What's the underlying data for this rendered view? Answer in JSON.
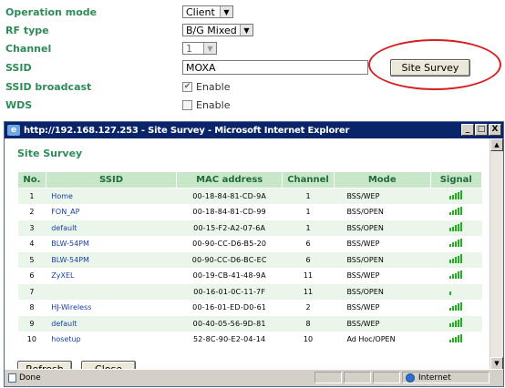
{
  "settings": {
    "operation_mode": {
      "label": "Operation mode",
      "value": "Client"
    },
    "rf_type": {
      "label": "RF type",
      "value": "B/G Mixed"
    },
    "channel": {
      "label": "Channel",
      "value": "1"
    },
    "ssid": {
      "label": "SSID",
      "value": "MOXA",
      "button": "Site Survey"
    },
    "ssid_broadcast": {
      "label": "SSID broadcast",
      "checkbox_label": "Enable",
      "checked": true
    },
    "wds": {
      "label": "WDS",
      "checkbox_label": "Enable",
      "checked": false
    },
    "highlight_color": "#d42020"
  },
  "window": {
    "title": "http://192.168.127.253 - Site Survey - Microsoft Internet Explorer",
    "controls": {
      "minimize": "_",
      "maximize": "□",
      "close": "X"
    }
  },
  "survey": {
    "title": "Site Survey",
    "columns": [
      "No.",
      "SSID",
      "MAC address",
      "Channel",
      "Mode",
      "Signal"
    ],
    "rows": [
      {
        "no": "1",
        "ssid": "Home",
        "mac": "00-18-84-81-CD-9A",
        "channel": "1",
        "mode": "BSS/WEP",
        "signal": 5
      },
      {
        "no": "2",
        "ssid": "FON_AP",
        "mac": "00-18-84-81-CD-99",
        "channel": "1",
        "mode": "BSS/OPEN",
        "signal": 5
      },
      {
        "no": "3",
        "ssid": "default",
        "mac": "00-15-F2-A2-07-6A",
        "channel": "1",
        "mode": "BSS/OPEN",
        "signal": 5
      },
      {
        "no": "4",
        "ssid": "BLW-54PM",
        "mac": "00-90-CC-D6-B5-20",
        "channel": "6",
        "mode": "BSS/WEP",
        "signal": 5
      },
      {
        "no": "5",
        "ssid": "BLW-54PM",
        "mac": "00-90-CC-D6-BC-EC",
        "channel": "6",
        "mode": "BSS/OPEN",
        "signal": 5
      },
      {
        "no": "6",
        "ssid": "ZyXEL",
        "mac": "00-19-CB-41-48-9A",
        "channel": "11",
        "mode": "BSS/WEP",
        "signal": 5
      },
      {
        "no": "7",
        "ssid": "",
        "mac": "00-16-01-0C-11-7F",
        "channel": "11",
        "mode": "BSS/OPEN",
        "signal": 1
      },
      {
        "no": "8",
        "ssid": "HJ-Wireless",
        "mac": "00-16-01-ED-D0-61",
        "channel": "2",
        "mode": "BSS/WEP",
        "signal": 5
      },
      {
        "no": "9",
        "ssid": "default",
        "mac": "00-40-05-56-9D-81",
        "channel": "8",
        "mode": "BSS/WEP",
        "signal": 5
      },
      {
        "no": "10",
        "ssid": "hosetup",
        "mac": "52-8C-90-E2-04-14",
        "channel": "10",
        "mode": "Ad Hoc/OPEN",
        "signal": 5
      }
    ],
    "buttons": {
      "refresh": "Refresh",
      "close": "Close"
    }
  },
  "statusbar": {
    "status": "Done",
    "zone": "Internet"
  },
  "colors": {
    "label_green": "#2e8b57",
    "header_bg": "#c8e6c8",
    "row_alt": "#eaf6ea",
    "link_blue": "#1a3faa",
    "signal_green": "#22b022"
  }
}
